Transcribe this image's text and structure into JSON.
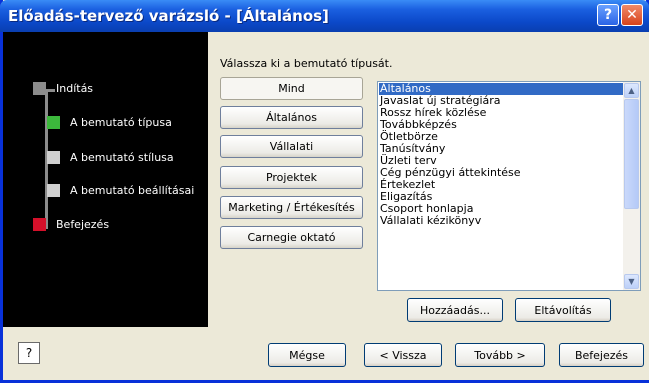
{
  "window": {
    "title": "Előadás-tervező varázsló - [Általános]"
  },
  "titlebar_buttons": {
    "help_icon": "question-icon",
    "close_icon": "close-icon",
    "help_glyph": "?",
    "close_glyph": "✕"
  },
  "steps": [
    {
      "label": "Indítás",
      "color": "#8c8c8c"
    },
    {
      "label": "A bemutató típusa",
      "color": "#3cb83c"
    },
    {
      "label": "A bemutató stílusa",
      "color": "#d0d0d0"
    },
    {
      "label": "A bemutató beállításai",
      "color": "#d0d0d0"
    },
    {
      "label": "Befejezés",
      "color": "#d4102a"
    }
  ],
  "content": {
    "prompt": "Válassza ki a bemutató típusát.",
    "categories": [
      "Mind",
      "Általános",
      "Vállalati",
      "Projektek",
      "Marketing / Értékesítés",
      "Carnegie oktató"
    ],
    "list_items": [
      "Általános",
      "Javaslat új stratégiára",
      "Rossz hírek közlése",
      "Továbbképzés",
      "Ötletbörze",
      "Tanúsítvány",
      "Üzleti terv",
      "Cég pénzügyi áttekintése",
      "Értekezlet",
      "Eligazítás",
      "Csoport honlapja",
      "Vállalati kézikönyv"
    ],
    "selected_item": "Általános",
    "add_button": "Hozzáadás...",
    "remove_button": "Eltávolítás"
  },
  "footer": {
    "help_icon": "help-icon",
    "help_glyph": "?",
    "cancel": "Mégse",
    "back": "< Vissza",
    "next": "Tovább >",
    "finish": "Befejezés"
  },
  "colors": {
    "title_bar": "#0b48c8",
    "selection": "#316ac5",
    "dialog_bg": "#ece9d8"
  }
}
